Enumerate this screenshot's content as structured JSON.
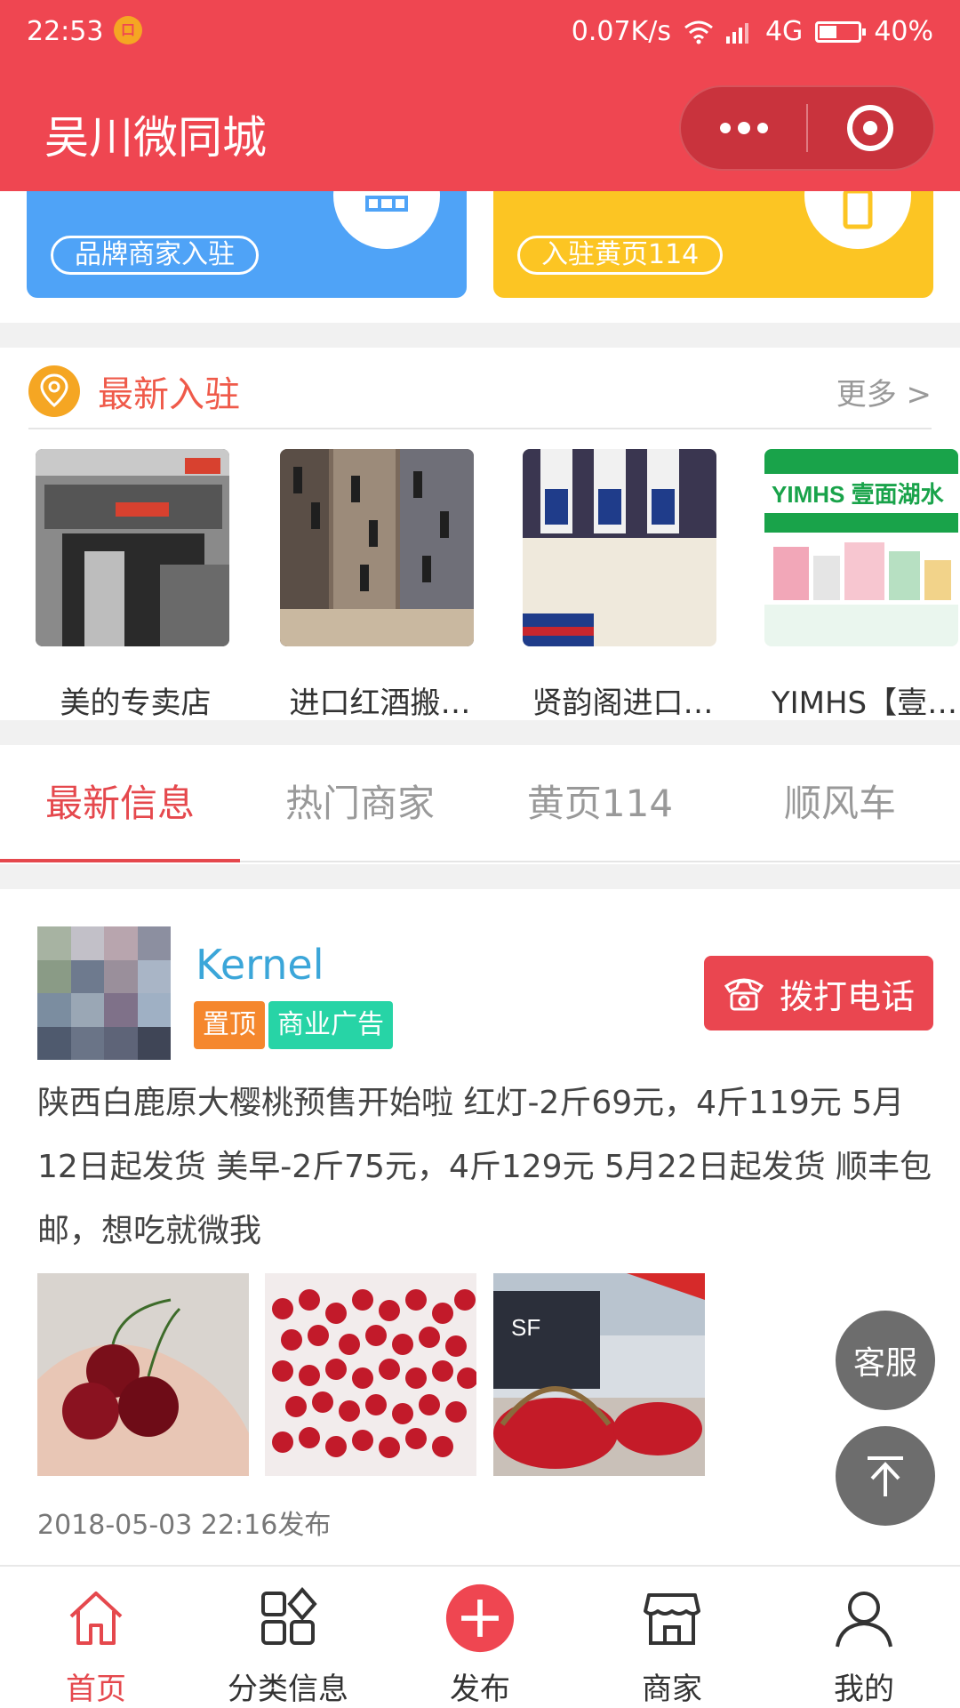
{
  "status_bar": {
    "time": "22:53",
    "network_speed": "0.07K/s",
    "network_type": "4G",
    "battery": "40%"
  },
  "app": {
    "title": "吴川微同城"
  },
  "banners": [
    {
      "label": "品牌商家入驻",
      "color": "#4fa3f7"
    },
    {
      "label": "入驻黄页114",
      "color": "#fcc523"
    }
  ],
  "newest": {
    "title": "最新入驻",
    "more": "更多 >",
    "shops": [
      {
        "name": "美的专卖店"
      },
      {
        "name": "进口红酒搬…"
      },
      {
        "name": "贤韵阁进口…"
      },
      {
        "name": "YIMHS【壹…",
        "image_text": "YIMHS 壹面湖水"
      }
    ]
  },
  "tabs": [
    {
      "label": "最新信息",
      "active": true
    },
    {
      "label": "热门商家",
      "active": false
    },
    {
      "label": "黄页114",
      "active": false
    },
    {
      "label": "顺风车",
      "active": false
    }
  ],
  "post": {
    "username": "Kernel",
    "tags": [
      "置顶",
      "商业广告"
    ],
    "call_label": "拨打电话",
    "text": "陕西白鹿原大樱桃预售开始啦 红灯-2斤69元，4斤119元 5月12日起发货 美早-2斤75元，4斤129元 5月22日起发货 顺丰包邮，想吃就微我",
    "time": "2018-05-03 22:16发布"
  },
  "floating": {
    "service": "客服"
  },
  "bottom_nav": [
    {
      "label": "首页",
      "icon": "home-icon",
      "active": true
    },
    {
      "label": "分类信息",
      "icon": "category-icon",
      "active": false
    },
    {
      "label": "发布",
      "icon": "add-icon",
      "active": false
    },
    {
      "label": "商家",
      "icon": "shop-icon",
      "active": false
    },
    {
      "label": "我的",
      "icon": "user-icon",
      "active": false
    }
  ],
  "colors": {
    "brand_red": "#ef4651",
    "tab_active": "#e5484d",
    "username_blue": "#3ba6d9"
  }
}
